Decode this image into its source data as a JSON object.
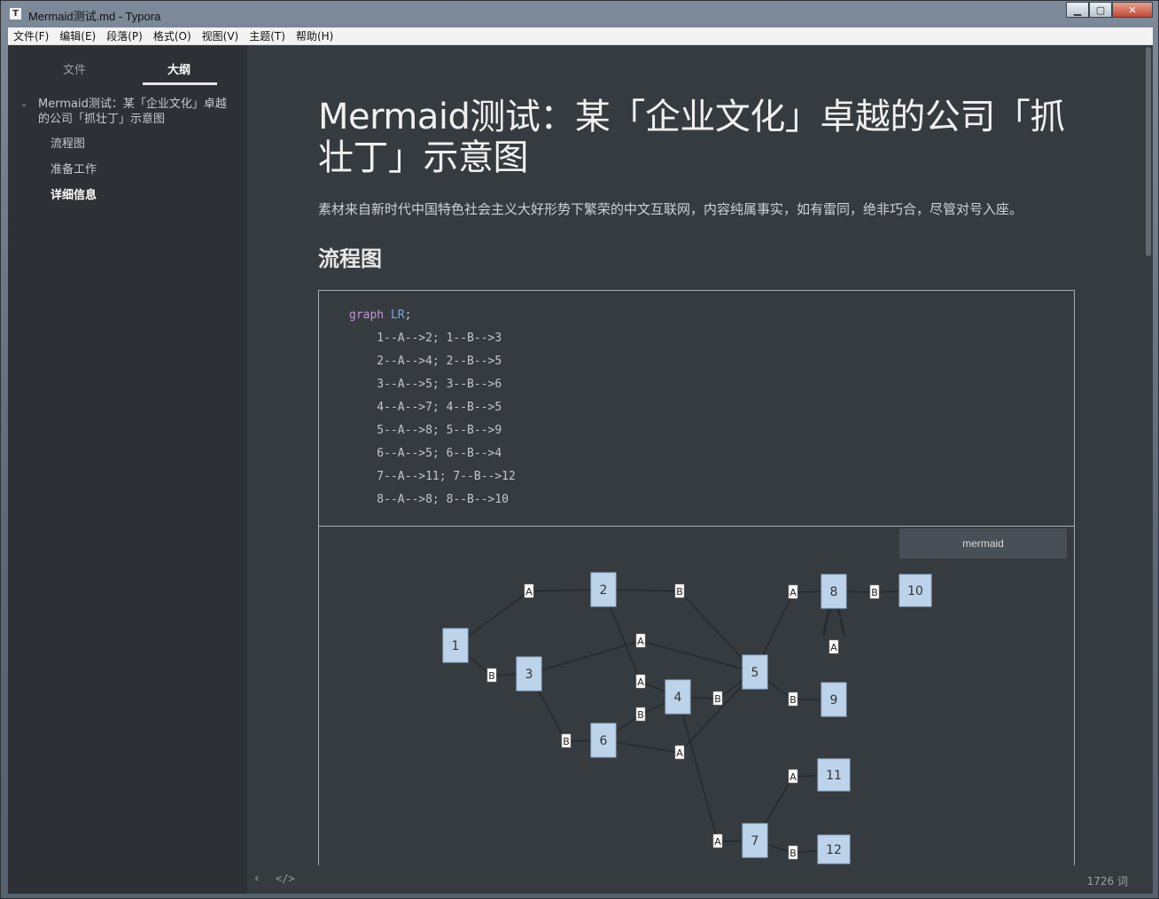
{
  "window": {
    "title": "Mermaid测试.md - Typora",
    "app_icon": "T",
    "minimize": "▁",
    "maximize": "▢",
    "close": "✕"
  },
  "menubar": [
    "文件(F)",
    "编辑(E)",
    "段落(P)",
    "格式(O)",
    "视图(V)",
    "主题(T)",
    "帮助(H)"
  ],
  "sidebar": {
    "tab_files": "文件",
    "tab_outline": "大纲",
    "outline_root_caret": "⌄",
    "outline_root": "Mermaid测试：某「企业文化」卓越的公司「抓壮丁」示意图",
    "items": [
      "流程图",
      "准备工作",
      "详细信息"
    ]
  },
  "document": {
    "title": "Mermaid测试：某「企业文化」卓越的公司「抓壮丁」示意图",
    "paragraph": "素材来自新时代中国特色社会主义大好形势下繁荣的中文互联网，内容纯属事实，如有雷同，绝非巧合，尽管对号入座。",
    "h2": "流程图",
    "code": {
      "keyword": "graph",
      "direction": "LR",
      "terminator": ";",
      "lines": [
        "    1--A-->2; 1--B-->3",
        "    2--A-->4; 2--B-->5",
        "    3--A-->5; 3--B-->6",
        "    4--A-->7; 4--B-->5",
        "    5--A-->8; 5--B-->9",
        "    6--A-->5; 6--B-->4",
        "    7--A-->11; 7--B-->12",
        "    8--A-->8; 8--B-->10"
      ]
    },
    "code_language": "mermaid",
    "graph": {
      "nodes": [
        "1",
        "2",
        "3",
        "4",
        "5",
        "6",
        "7",
        "8",
        "9",
        "10",
        "11",
        "12"
      ],
      "edges": [
        {
          "from": "1",
          "to": "2",
          "label": "A"
        },
        {
          "from": "1",
          "to": "3",
          "label": "B"
        },
        {
          "from": "2",
          "to": "4",
          "label": "A"
        },
        {
          "from": "2",
          "to": "5",
          "label": "B"
        },
        {
          "from": "3",
          "to": "5",
          "label": "A"
        },
        {
          "from": "3",
          "to": "6",
          "label": "B"
        },
        {
          "from": "4",
          "to": "7",
          "label": "A"
        },
        {
          "from": "4",
          "to": "5",
          "label": "B"
        },
        {
          "from": "5",
          "to": "8",
          "label": "A"
        },
        {
          "from": "5",
          "to": "9",
          "label": "B"
        },
        {
          "from": "6",
          "to": "5",
          "label": "A"
        },
        {
          "from": "6",
          "to": "4",
          "label": "B"
        },
        {
          "from": "7",
          "to": "11",
          "label": "A"
        },
        {
          "from": "7",
          "to": "12",
          "label": "B"
        },
        {
          "from": "8",
          "to": "8",
          "label": "A"
        },
        {
          "from": "8",
          "to": "10",
          "label": "B"
        }
      ]
    }
  },
  "footer": {
    "back_icon": "‹",
    "source_icon": "</>",
    "word_count": "1726 词"
  },
  "colors": {
    "editor_bg": "#363b40",
    "sidebar_bg": "#2d3034",
    "node_fill": "#bcd3ea",
    "edge": "#262a2e"
  }
}
